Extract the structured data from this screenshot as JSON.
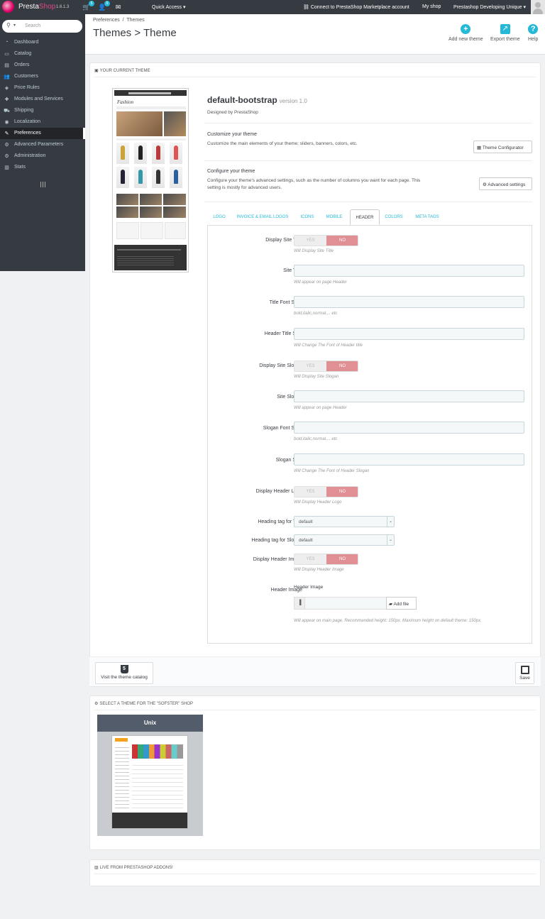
{
  "topbar": {
    "brand_part1": "Presta",
    "brand_part2": "Shop",
    "version": "1.6.1.3",
    "orders_badge": "5",
    "customers_badge": "5",
    "quick_access": "Quick Access ▾",
    "marketplace": "Connect to PrestaShop Marketplace account",
    "my_shop": "My shop",
    "employee": "Prestashop Developing Unique ▾"
  },
  "sidebar": {
    "search_placeholder": "Search",
    "items": [
      {
        "label": "Dashboard",
        "icon": "tachometer-icon",
        "glyph": "◔"
      },
      {
        "label": "Catalog",
        "icon": "folder-icon",
        "glyph": "▭"
      },
      {
        "label": "Orders",
        "icon": "credit-card-icon",
        "glyph": "▤"
      },
      {
        "label": "Customers",
        "icon": "users-icon",
        "glyph": "👥"
      },
      {
        "label": "Price Rules",
        "icon": "tags-icon",
        "glyph": "◈"
      },
      {
        "label": "Modules and Services",
        "icon": "puzzle-icon",
        "glyph": "✚"
      },
      {
        "label": "Shipping",
        "icon": "truck-icon",
        "glyph": "⛟"
      },
      {
        "label": "Localization",
        "icon": "globe-icon",
        "glyph": "◉"
      },
      {
        "label": "Preferences",
        "icon": "wrench-icon",
        "glyph": "✎"
      },
      {
        "label": "Advanced Parameters",
        "icon": "cogs-icon",
        "glyph": "⚙"
      },
      {
        "label": "Administration",
        "icon": "cog-icon",
        "glyph": "⚙"
      },
      {
        "label": "Stats",
        "icon": "bar-chart-icon",
        "glyph": "▥"
      }
    ]
  },
  "header": {
    "breadcrumb_1": "Preferences",
    "breadcrumb_sep": "/",
    "breadcrumb_2": "Themes",
    "title": "Themes > Theme",
    "btn_add": "Add new theme",
    "btn_export": "Export theme",
    "btn_help": "Help"
  },
  "current_theme": {
    "panel_title": "YOUR CURRENT THEME",
    "thumb_logo": "Fashion",
    "name": "default-bootstrap",
    "version": "version 1.0",
    "designed_by": "Designed by PrestaShop",
    "customize_title": "Customize your theme",
    "customize_desc": "Customize the main elements of your theme: sliders, banners, colors, etc.",
    "configurator_btn": "Theme Configurator",
    "configure_title": "Configure your theme",
    "configure_desc": "Configure your theme's advanced settings, such as the number of columns you want for each page. This setting is mostly for advanced users.",
    "advanced_btn": "Advanced settings"
  },
  "tabs": [
    "LOGO",
    "INVOICE & EMAIL LOGOS",
    "ICONS",
    "MOBILE",
    "HEADER",
    "COLORS",
    "META TAGS"
  ],
  "form": {
    "display_site_title": {
      "label": "Display Site Title",
      "yes": "YES",
      "no": "NO",
      "value": "NO",
      "help": "Will Display Site Title"
    },
    "site_title": {
      "label": "Site Title",
      "value": "",
      "help": "Will appear on page Header"
    },
    "title_font_style": {
      "label": "Title Font Style",
      "value": "",
      "help": "bold,italic,normal.... etc"
    },
    "header_title_size": {
      "label": "Header Title Size",
      "value": "",
      "help": "Will Change The Font of Header title"
    },
    "display_site_slogan": {
      "label": "Display Site Slogan",
      "yes": "YES",
      "no": "NO",
      "value": "NO",
      "help": "Will Display Site Slogan"
    },
    "site_slogan": {
      "label": "Site Slogan",
      "value": "",
      "help": "Will appear on page Header"
    },
    "slogan_font_style": {
      "label": "Slogan Font Style",
      "value": "",
      "help": "bold,italic,normal.... etc"
    },
    "slogan_size": {
      "label": "Slogan Size",
      "value": "",
      "help": "Will Change The Font of Header Slogan"
    },
    "display_header_logo": {
      "label": "Display Header Logo",
      "yes": "YES",
      "no": "NO",
      "value": "NO",
      "help": "Will Display Header Logo"
    },
    "heading_tag_title": {
      "label": "Heading tag for Title",
      "value": "default"
    },
    "heading_tag_slogan": {
      "label": "Heading tag for Slogan",
      "value": "default"
    },
    "display_header_image": {
      "label": "Display Header Image",
      "yes": "YES",
      "no": "NO",
      "value": "NO",
      "help": "Will Display Header Image"
    },
    "header_image": {
      "label": "Header Image",
      "sub_label": "Header Image",
      "add_file": "Add file",
      "help": "Will appear on main page. Recommended height: 150px. Maximum height on default theme: 150px."
    }
  },
  "footer": {
    "catalog_btn": "Visit the theme catalog",
    "save_btn": "Save"
  },
  "select_theme": {
    "panel_title": "SELECT A THEME FOR THE \"SOFSTER\" SHOP",
    "card_name": "Unix"
  },
  "addons": {
    "panel_title": "LIVE FROM PRESTASHOP ADDONS!"
  },
  "colors": {
    "accent": "#25b9d7",
    "sidebar_bg": "#363a41",
    "toggle_no": "#e08f95"
  }
}
